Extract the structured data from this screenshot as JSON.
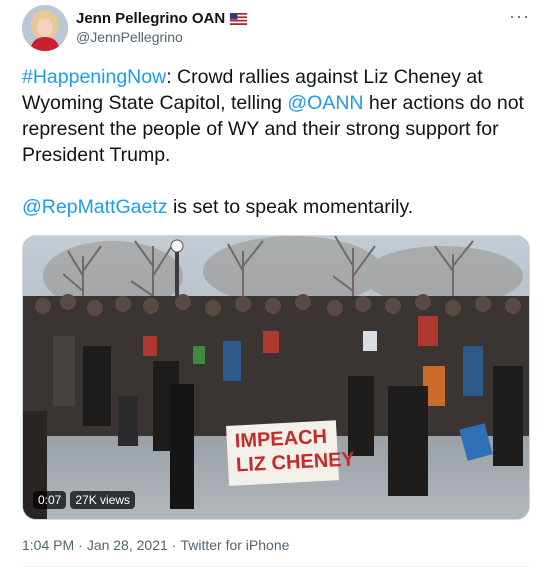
{
  "author": {
    "display_name": "Jenn Pellegrino OAN",
    "flag": "us-flag-icon",
    "handle": "@JennPellegrino"
  },
  "more_label": "···",
  "tweet": {
    "hashtag": "#HappeningNow",
    "text_part1": ": Crowd rallies against Liz Cheney at Wyoming State Capitol, telling ",
    "mention1": "@OANN",
    "text_part2": " her actions do not represent the people of WY and their strong support for President Trump.",
    "mention2": "@RepMattGaetz",
    "text_part3": " is set to speak momentarily."
  },
  "media": {
    "type": "video",
    "duration": "0:07",
    "views": "27K views",
    "sign_text": "IMPEACH LIZ CHENEY"
  },
  "meta": {
    "time": "1:04 PM",
    "date": "Jan 28, 2021",
    "source": "Twitter for iPhone",
    "separator": "·"
  },
  "colors": {
    "link": "#1d9bf0",
    "text": "#0f1419",
    "secondary": "#536471"
  }
}
